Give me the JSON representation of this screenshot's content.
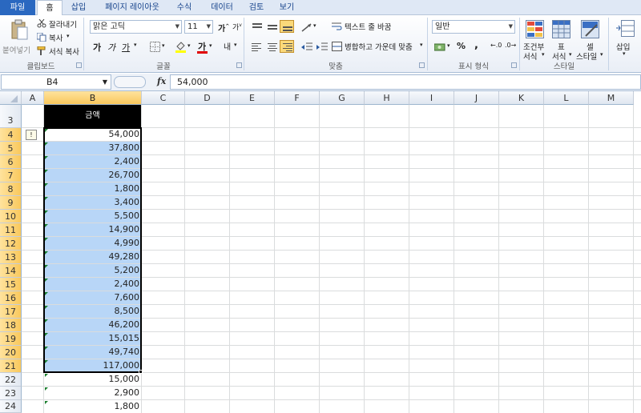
{
  "tabs": [
    "파일",
    "홈",
    "삽입",
    "페이지 레이아웃",
    "수식",
    "데이터",
    "검토",
    "보기"
  ],
  "clipboard": {
    "paste": "붙여넣기",
    "cut": "잘라내기",
    "copy": "복사",
    "format_painter": "서식 복사",
    "label": "클립보드"
  },
  "font": {
    "name": "맑은 고딕",
    "size": "11",
    "bold": "가",
    "italic": "가",
    "underline": "가",
    "color_a": "가",
    "phonetic": "내",
    "label": "글꼴"
  },
  "alignment": {
    "wrap": "텍스트 줄 바꿈",
    "merge": "병합하고 가운데 맞춤",
    "label": "맞춤"
  },
  "number": {
    "format": "일반",
    "percent": "%",
    "comma": ",",
    "label": "표시 형식"
  },
  "styles": {
    "conditional": [
      "조건부",
      "서식"
    ],
    "table": [
      "표",
      "서식"
    ],
    "cell": [
      "셀",
      "스타일"
    ],
    "label": "스타일"
  },
  "cells": {
    "insert": "삽입"
  },
  "formula_bar": {
    "name_box": "B4",
    "fx": "fx",
    "value": "54,000"
  },
  "columns": [
    "A",
    "B",
    "C",
    "D",
    "E",
    "F",
    "G",
    "H",
    "I",
    "J",
    "K",
    "L",
    "M"
  ],
  "header_cell": "금액",
  "rows": [
    {
      "row": "3",
      "value": ""
    },
    {
      "row": "4",
      "value": "54,000"
    },
    {
      "row": "5",
      "value": "37,800"
    },
    {
      "row": "6",
      "value": "2,400"
    },
    {
      "row": "7",
      "value": "26,700"
    },
    {
      "row": "8",
      "value": "1,800"
    },
    {
      "row": "9",
      "value": "3,400"
    },
    {
      "row": "10",
      "value": "5,500"
    },
    {
      "row": "11",
      "value": "14,900"
    },
    {
      "row": "12",
      "value": "4,990"
    },
    {
      "row": "13",
      "value": "49,280"
    },
    {
      "row": "14",
      "value": "5,200"
    },
    {
      "row": "15",
      "value": "2,400"
    },
    {
      "row": "16",
      "value": "7,600"
    },
    {
      "row": "17",
      "value": "8,500"
    },
    {
      "row": "18",
      "value": "46,200"
    },
    {
      "row": "19",
      "value": "15,015"
    },
    {
      "row": "20",
      "value": "49,740"
    },
    {
      "row": "21",
      "value": "117,000"
    },
    {
      "row": "22",
      "value": "15,000"
    },
    {
      "row": "23",
      "value": "2,900"
    },
    {
      "row": "24",
      "value": "1,800"
    }
  ],
  "selected_rows": [
    "4",
    "21"
  ],
  "colors": {
    "selection_fill": "#b8d6f7",
    "header_highlight": "#f9c85d",
    "error_triangle": "#1a7f2e",
    "file_tab": "#2a68c0"
  },
  "icons": [
    "paste-icon",
    "scissors-icon",
    "copy-icon",
    "format-painter-icon",
    "border-icon",
    "fill-color-icon",
    "font-color-icon",
    "align-top-icon",
    "align-middle-icon",
    "align-bottom-icon",
    "orientation-icon",
    "align-left-icon",
    "align-center-icon",
    "align-right-icon",
    "decrease-indent-icon",
    "increase-indent-icon",
    "wrap-text-icon",
    "merge-center-icon",
    "currency-icon",
    "increase-decimal-icon",
    "decrease-decimal-icon",
    "conditional-format-icon",
    "format-table-icon",
    "cell-styles-icon",
    "insert-cells-icon",
    "error-warning-icon"
  ]
}
